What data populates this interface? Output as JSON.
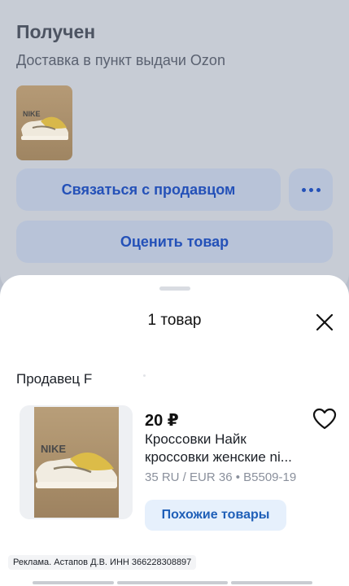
{
  "order": {
    "status": "Получен",
    "delivery": "Доставка в пункт выдачи Ozon",
    "contact_button": "Связаться с продавцом",
    "more_button_icon": "more-dots-icon",
    "rate_button": "Оценить товар"
  },
  "sheet": {
    "title": "1 товар",
    "close_icon": "close-icon",
    "seller": "Продавец F",
    "product": {
      "price": "20 ₽",
      "name_line1": "Кроссовки Найк",
      "name_line2": "кроссовки женские ni...",
      "meta": "35 RU / EUR 36 • B5509-19",
      "image_logo": "NIKE",
      "similar_button": "Похожие товары",
      "favorite_icon": "heart-icon"
    },
    "ad_text": "Реклама. Астапов Д.В. ИНН 366228308897"
  },
  "colors": {
    "accent": "#2451b8",
    "similar_bg": "#e6f0fc",
    "dim_bg": "#c7ccd5"
  }
}
